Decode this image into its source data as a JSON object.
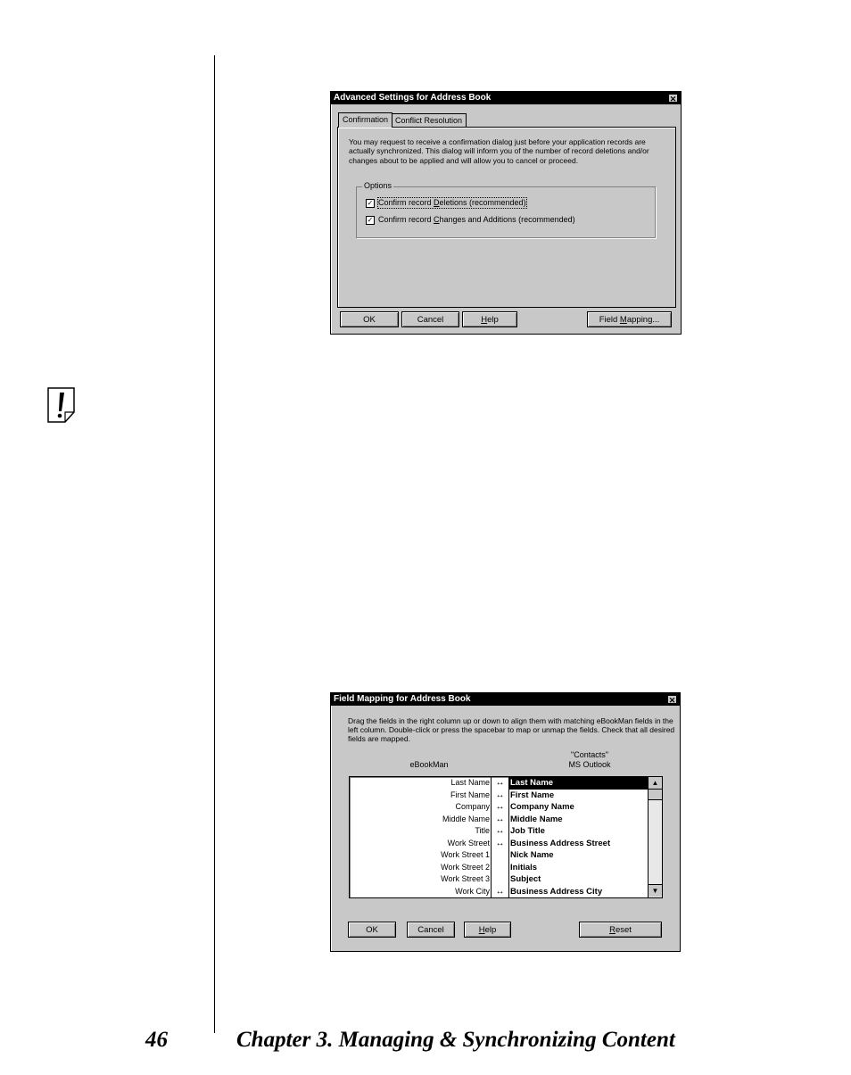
{
  "dialog1": {
    "title": "Advanced Settings for Address Book",
    "tabs": [
      "Confirmation",
      "Conflict Resolution"
    ],
    "description": "You may request to receive a confirmation dialog just before your application records are actually synchronized.  This dialog will inform you of the number of record deletions and/or changes about to be applied and will allow you to cancel or proceed.",
    "options_label": "Options",
    "options": [
      {
        "pre": "Confirm record ",
        "key": "D",
        "post": "eletions (recommended)",
        "checked": true
      },
      {
        "pre": "Confirm record ",
        "key": "C",
        "post": "hanges and Additions (recommended)",
        "checked": true
      }
    ],
    "buttons": {
      "ok": "OK",
      "cancel": "Cancel",
      "help_key": "H",
      "help_rest": "elp",
      "fm_pre": "Field ",
      "fm_key": "M",
      "fm_post": "apping..."
    }
  },
  "dialog2": {
    "title": "Field Mapping for Address Book",
    "description": "Drag the fields in the right column up or down to align them with matching eBookMan fields in the left column.  Double-click or press the spacebar to map or unmap the fields.  Check that all desired fields are mapped.",
    "left_header": "eBookMan",
    "right_header_line1": "\"Contacts\"",
    "right_header_line2": "MS Outlook",
    "rows": [
      {
        "left": "Last Name",
        "right": "Last Name",
        "mapped": true,
        "selected": true
      },
      {
        "left": "First Name",
        "right": "First Name",
        "mapped": true
      },
      {
        "left": "Company",
        "right": "Company Name",
        "mapped": true
      },
      {
        "left": "Middle Name",
        "right": "Middle Name",
        "mapped": true
      },
      {
        "left": "Title",
        "right": "Job Title",
        "mapped": true
      },
      {
        "left": "Work Street",
        "right": "Business Address Street",
        "mapped": true
      },
      {
        "left": "Work Street 1",
        "right": "Nick Name",
        "mapped": false
      },
      {
        "left": "Work Street 2",
        "right": "Initials",
        "mapped": false
      },
      {
        "left": "Work Street 3",
        "right": "Subject",
        "mapped": false
      },
      {
        "left": "Work City",
        "right": "Business Address City",
        "mapped": true
      }
    ],
    "buttons": {
      "ok": "OK",
      "cancel": "Cancel",
      "help_key": "H",
      "help_rest": "elp",
      "reset_key": "R",
      "reset_rest": "eset"
    }
  },
  "footer": {
    "page_number": "46",
    "chapter": "Chapter 3. Managing & Synchronizing Content"
  },
  "icons": {
    "note": "note-exclamation-icon",
    "close": "close-icon",
    "check": "✓",
    "arrow": "↔",
    "scroll_up": "▲",
    "scroll_down": "▼",
    "close_glyph": "✕"
  }
}
